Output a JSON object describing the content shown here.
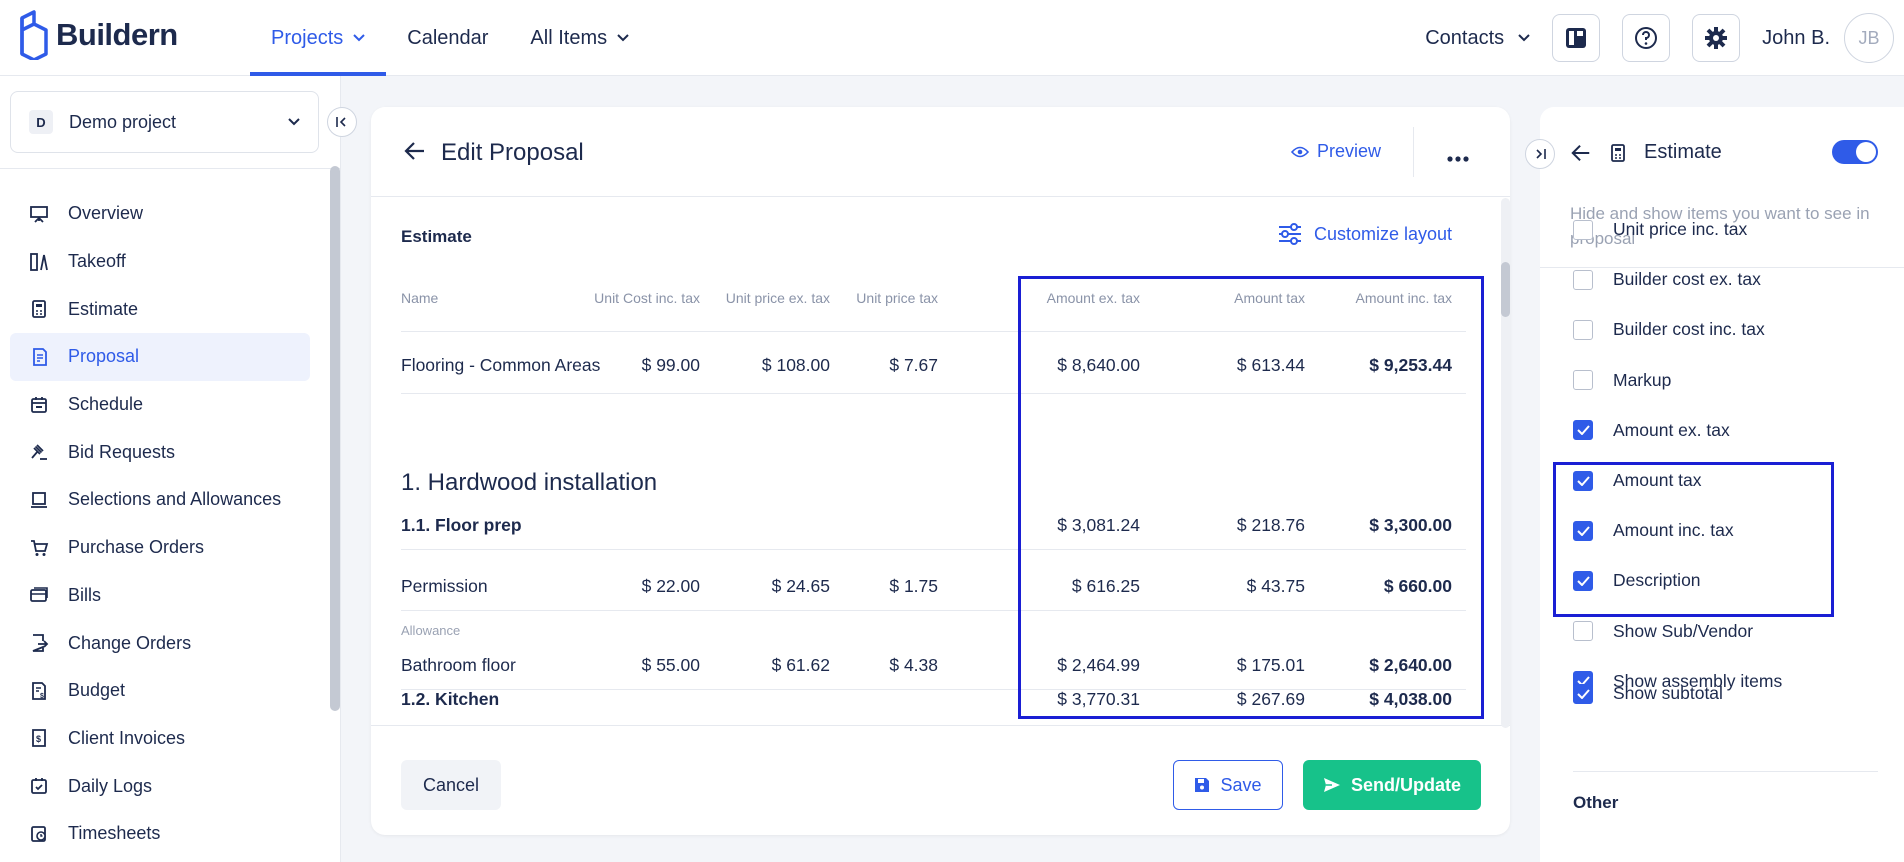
{
  "brand": {
    "name": "Buildern"
  },
  "nav": {
    "items": [
      {
        "label": "Projects",
        "active": true,
        "dropdown": true
      },
      {
        "label": "Calendar",
        "active": false,
        "dropdown": false
      },
      {
        "label": "All Items",
        "active": false,
        "dropdown": true
      }
    ],
    "contacts_label": "Contacts",
    "user_name": "John B.",
    "user_initials": "JB"
  },
  "sidebar": {
    "project_badge": "D",
    "project_name": "Demo project",
    "items": [
      {
        "label": "Overview",
        "icon": "presentation-icon"
      },
      {
        "label": "Takeoff",
        "icon": "takeoff-icon"
      },
      {
        "label": "Estimate",
        "icon": "calculator-icon"
      },
      {
        "label": "Proposal",
        "icon": "proposal-icon",
        "active": true
      },
      {
        "label": "Schedule",
        "icon": "calendar-icon"
      },
      {
        "label": "Bid Requests",
        "icon": "gavel-icon"
      },
      {
        "label": "Selections and Allowances",
        "icon": "selections-icon"
      },
      {
        "label": "Purchase Orders",
        "icon": "cart-icon"
      },
      {
        "label": "Bills",
        "icon": "bills-icon"
      },
      {
        "label": "Change Orders",
        "icon": "change-orders-icon"
      },
      {
        "label": "Budget",
        "icon": "budget-icon"
      },
      {
        "label": "Client Invoices",
        "icon": "invoice-icon"
      },
      {
        "label": "Daily Logs",
        "icon": "daily-log-icon"
      },
      {
        "label": "Timesheets",
        "icon": "timesheet-icon"
      }
    ]
  },
  "proposal": {
    "title": "Edit Proposal",
    "preview_label": "Preview",
    "section_label": "Estimate",
    "customize_label": "Customize layout",
    "columns": [
      "Name",
      "Unit Cost inc. tax",
      "Unit price ex. tax",
      "Unit price tax",
      "Amount ex. tax",
      "Amount tax",
      "Amount inc. tax"
    ],
    "row1": {
      "name": "Flooring - Common Areas",
      "unit_cost": "$ 99.00",
      "unit_price_ex": "$ 108.00",
      "unit_price_tax": "$ 7.67",
      "amount_ex": "$ 8,640.00",
      "amount_tax": "$ 613.44",
      "amount_inc": "$ 9,253.44"
    },
    "group_title": "1. Hardwood installation",
    "sub1": {
      "name": "1.1. Floor prep",
      "amount_ex": "$ 3,081.24",
      "amount_tax": "$ 218.76",
      "amount_inc": "$ 3,300.00"
    },
    "row2": {
      "name": "Permission",
      "unit_cost": "$ 22.00",
      "unit_price_ex": "$ 24.65",
      "unit_price_tax": "$ 1.75",
      "amount_ex": "$ 616.25",
      "amount_tax": "$ 43.75",
      "amount_inc": "$ 660.00"
    },
    "row3": {
      "tag": "Allowance",
      "name": "Bathroom floor",
      "unit_cost": "$ 55.00",
      "unit_price_ex": "$ 61.62",
      "unit_price_tax": "$ 4.38",
      "amount_ex": "$ 2,464.99",
      "amount_tax": "$ 175.01",
      "amount_inc": "$ 2,640.00"
    },
    "sub2": {
      "name": "1.2. Kitchen",
      "amount_ex": "$ 3,770.31",
      "amount_tax": "$ 267.69",
      "amount_inc": "$ 4,038.00"
    },
    "cancel_label": "Cancel",
    "save_label": "Save",
    "send_label": "Send/Update"
  },
  "panel": {
    "title": "Estimate",
    "toggle_on": true,
    "description": "Hide and show items you want to see in proposal",
    "options": [
      {
        "label": "Unit price inc. tax",
        "checked": false
      },
      {
        "label": "Builder cost ex. tax",
        "checked": false
      },
      {
        "label": "Builder cost inc. tax",
        "checked": false
      },
      {
        "label": "Markup",
        "checked": false
      },
      {
        "label": "Amount ex. tax",
        "checked": true
      },
      {
        "label": "Amount tax",
        "checked": true
      },
      {
        "label": "Amount inc. tax",
        "checked": true
      },
      {
        "label": "Description",
        "checked": true
      },
      {
        "label": "Show Sub/Vendor",
        "checked": false
      },
      {
        "label": "Show assembly items",
        "checked": true
      }
    ],
    "other_label": "Other",
    "other_options": [
      {
        "label": "Show subtotal",
        "checked": true
      }
    ]
  },
  "colors": {
    "accent": "#2f5be8",
    "success": "#17c28a",
    "highlight": "#1a1fd4"
  }
}
